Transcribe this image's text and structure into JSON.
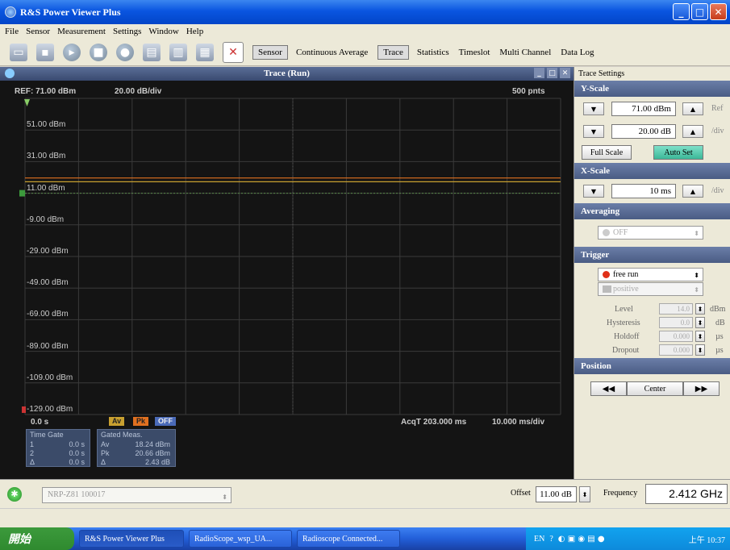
{
  "app": {
    "title": "R&S Power Viewer Plus"
  },
  "menu": [
    "File",
    "Sensor",
    "Measurement",
    "Settings",
    "Window",
    "Help"
  ],
  "toolbar": {
    "sensor": "Sensor",
    "continuous_average": "Continuous Average",
    "trace": "Trace",
    "statistics": "Statistics",
    "timeslot": "Timeslot",
    "multi_channel": "Multi Channel",
    "data_log": "Data Log"
  },
  "trace": {
    "title": "Trace  (Run)",
    "ref": "REF: 71.00 dBm",
    "div": "20.00 dB/div",
    "points": "500 pnts",
    "x_start": "0.0 s",
    "acq": "AcqT 203.000 ms",
    "ms_div": "10.000 ms/div",
    "badges": {
      "av": "Av",
      "pk": "Pk",
      "off": "OFF"
    }
  },
  "y_labels": [
    "51.00 dBm",
    "31.00 dBm",
    "11.00 dBm",
    "-9.00 dBm",
    "-29.00 dBm",
    "-49.00 dBm",
    "-69.00 dBm",
    "-89.00 dBm",
    "-109.00 dBm",
    "-129.00 dBm"
  ],
  "gates": {
    "time_gate": {
      "title": "Time Gate",
      "rows": [
        [
          "1",
          "0.0 s"
        ],
        [
          "2",
          "0.0 s"
        ],
        [
          "Δ",
          "0.0 s"
        ]
      ]
    },
    "gated_meas": {
      "title": "Gated Meas.",
      "rows": [
        [
          "Av",
          "18.24 dBm"
        ],
        [
          "Pk",
          "20.66 dBm"
        ],
        [
          "Δ",
          "2.43 dB"
        ]
      ]
    }
  },
  "settings": {
    "title": "Trace Settings",
    "yscale": "Y-Scale",
    "ref_val": "71.00 dBm",
    "ref_unit": "Ref",
    "div_val": "20.00 dB",
    "div_unit": "/div",
    "full_scale": "Full Scale",
    "auto_set": "Auto Set",
    "xscale": "X-Scale",
    "x_val": "10 ms",
    "x_unit": "/div",
    "averaging": "Averaging",
    "avg_val": "OFF",
    "trigger": "Trigger",
    "trig_mode": "free run",
    "trig_slope": "positive",
    "level_lbl": "Level",
    "level_val": "14.0",
    "level_unit": "dBm",
    "hyst_lbl": "Hysteresis",
    "hyst_val": "0.0",
    "hyst_unit": "dB",
    "holdoff_lbl": "Holdoff",
    "holdoff_val": "0.000",
    "holdoff_unit": "µs",
    "dropout_lbl": "Dropout",
    "dropout_val": "0.000",
    "dropout_unit": "µs",
    "position": "Position",
    "center": "Center"
  },
  "status": {
    "sensor": "NRP-Z81 100017",
    "offset_lbl": "Offset",
    "offset_val": "11.00 dB",
    "freq_lbl": "Frequency",
    "freq_val": "2.412 GHz"
  },
  "taskbar": {
    "start": "開始",
    "tasks": [
      "R&S Power Viewer Plus",
      "RadioScope_wsp_UA...",
      "Radioscope Connected..."
    ],
    "lang": "EN",
    "clock": "上午 10:37"
  },
  "chart_data": {
    "type": "line",
    "title": "Trace  (Run)",
    "ylim": [
      -129,
      71
    ],
    "series": [
      {
        "name": "Av",
        "level_dbm": 18.24
      },
      {
        "name": "Pk",
        "level_dbm": 20.66
      }
    ],
    "trigger_level_dbm": 11.0
  }
}
